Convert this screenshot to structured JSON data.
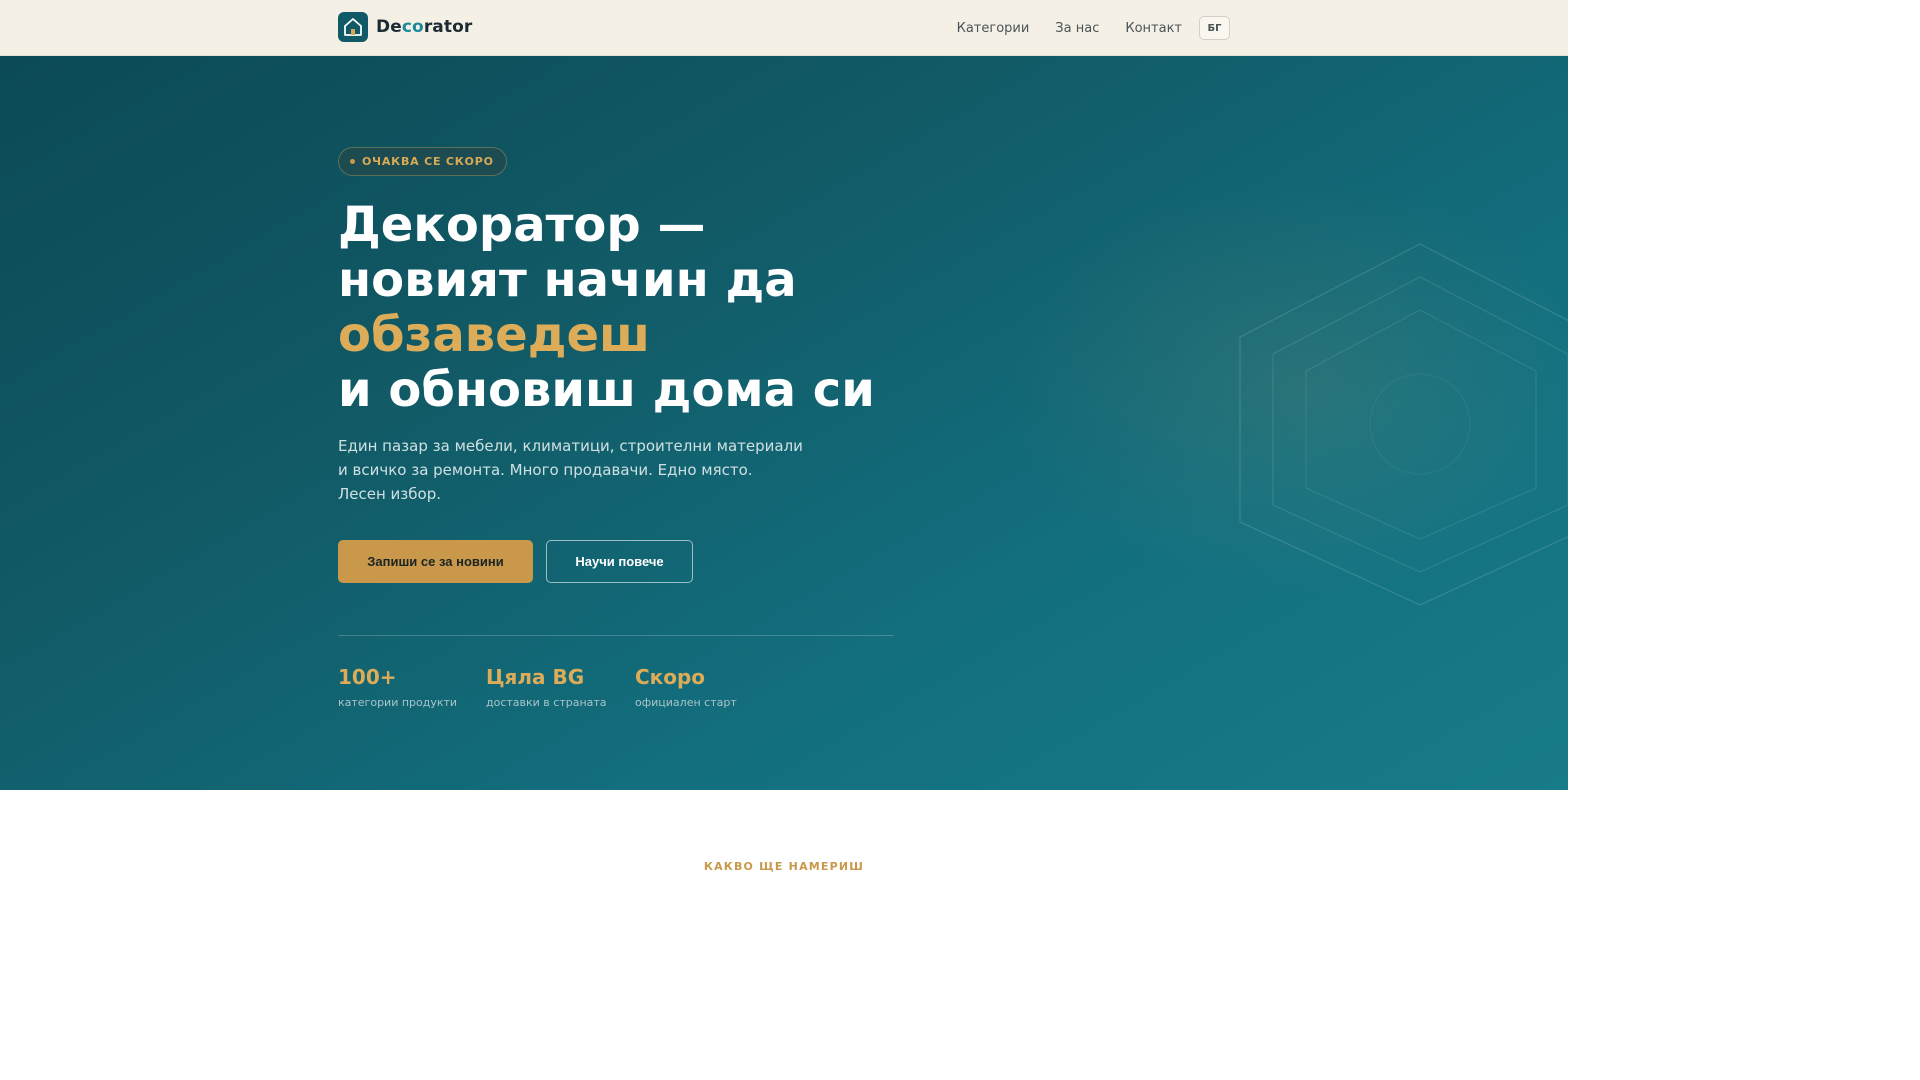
{
  "header": {
    "logo_icon": "house-icon",
    "brand_prefix": "De",
    "brand_accent": "co",
    "brand_suffix": "rator",
    "nav": [
      "Категории",
      "За нас",
      "Контакт"
    ],
    "language": "БГ"
  },
  "hero": {
    "badge": "ОЧАКВА СЕ СКОРО",
    "headline_line1": "Декоратор —",
    "headline_line2": "новият начин да",
    "headline_highlight": "обзаведеш",
    "headline_line4": "и обновиш дома си",
    "sub_line1": "Един пазар за мебели, климатици, строителни материали",
    "sub_line2": "и всичко за ремонта. Много продавачи. Едно място.",
    "sub_line3": "Лесен избор.",
    "primary_button": "Запиши се за новини",
    "secondary_button": "Научи повече",
    "stats": [
      {
        "value": "100+",
        "label": "категории продукти"
      },
      {
        "value": "Цяла BG",
        "label": "доставки в страната"
      },
      {
        "value": "Скоро",
        "label": "официален старт"
      }
    ]
  },
  "next_section": {
    "eyebrow": "КАКВО ЩЕ НАМЕРИШ"
  },
  "colors": {
    "accent_gold": "#ddac59",
    "button_gold": "#c9984a",
    "teal_dark": "#0b4a56",
    "teal_light": "#187b89",
    "header_bg": "#f5f0e6"
  }
}
